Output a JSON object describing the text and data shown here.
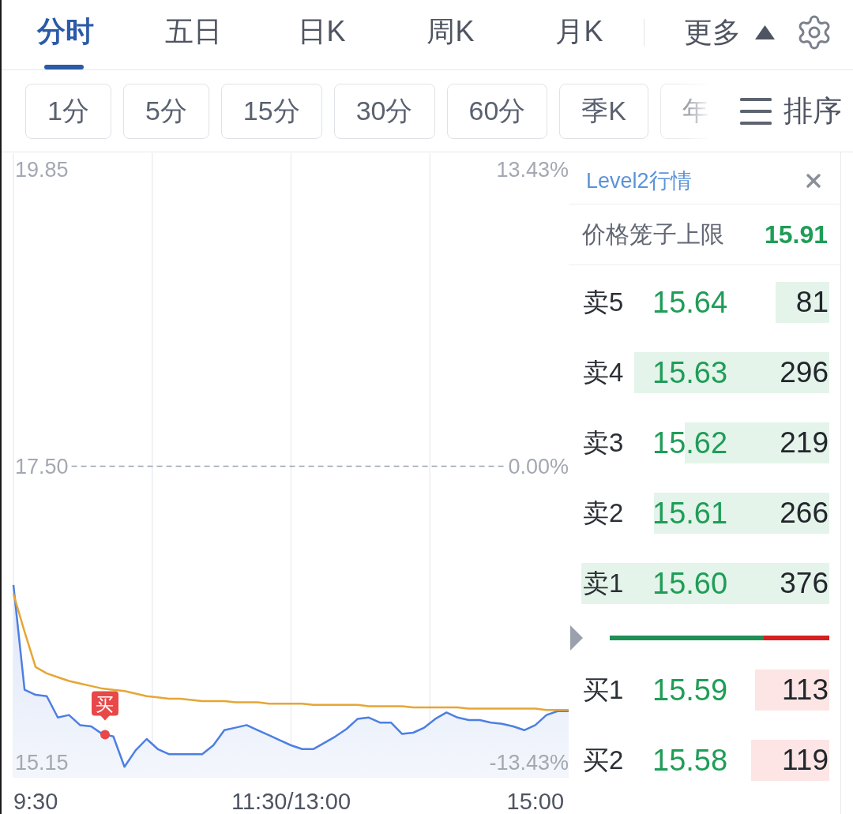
{
  "tabs": [
    {
      "label": "分时",
      "selected": true
    },
    {
      "label": "五日",
      "selected": false
    },
    {
      "label": "日K",
      "selected": false
    },
    {
      "label": "周K",
      "selected": false
    },
    {
      "label": "月K",
      "selected": false
    }
  ],
  "more": {
    "label": "更多",
    "expanded": true
  },
  "periods": [
    "1分",
    "5分",
    "15分",
    "30分",
    "60分",
    "季K",
    "年"
  ],
  "sort": {
    "label": "排序"
  },
  "chart": {
    "percent_labels": [
      "13.43%",
      "0.00%",
      "-13.43%"
    ],
    "chart_data": {
      "type": "line",
      "categories": [
        null,
        null,
        "9:30",
        null,
        null,
        null,
        null,
        null,
        null,
        null,
        null,
        null,
        null,
        null,
        null,
        null,
        null,
        null,
        null,
        null,
        null,
        null,
        null,
        null,
        null,
        "11:30/13:00",
        null,
        null,
        null,
        null,
        null,
        null,
        null,
        null,
        null,
        null,
        null,
        null,
        null,
        null,
        null,
        null,
        null,
        null,
        null,
        null,
        null,
        "15:00",
        null,
        null,
        null
      ],
      "ylim": [
        15.04,
        19.98
      ],
      "yticks": [
        {
          "value": 19.85,
          "label": "19.85"
        },
        {
          "value": 17.5,
          "label": "17.50"
        },
        {
          "value": 15.15,
          "label": "15.15"
        }
      ],
      "series": [
        {
          "color": "#4d7fe3",
          "values": [
            16.56,
            15.73,
            15.69,
            15.68,
            15.51,
            15.53,
            15.45,
            15.44,
            15.38,
            15.36,
            15.12,
            15.25,
            15.34,
            15.26,
            15.22,
            15.22,
            15.22,
            15.22,
            15.29,
            15.41,
            15.43,
            15.45,
            15.41,
            15.37,
            15.33,
            15.29,
            15.26,
            15.26,
            15.31,
            15.36,
            15.42,
            15.5,
            15.51,
            15.47,
            15.47,
            15.38,
            15.39,
            15.43,
            15.5,
            15.55,
            15.51,
            15.49,
            15.49,
            15.47,
            15.46,
            15.44,
            15.41,
            15.45,
            15.53,
            15.56,
            15.56
          ]
        },
        {
          "color": "#e6a634",
          "values": [
            16.49,
            16.19,
            15.91,
            15.86,
            15.83,
            15.8,
            15.78,
            15.76,
            15.74,
            15.73,
            15.72,
            15.7,
            15.68,
            15.67,
            15.66,
            15.66,
            15.65,
            15.64,
            15.64,
            15.64,
            15.63,
            15.63,
            15.63,
            15.62,
            15.62,
            15.62,
            15.62,
            15.61,
            15.61,
            15.61,
            15.61,
            15.61,
            15.6,
            15.6,
            15.6,
            15.6,
            15.59,
            15.59,
            15.59,
            15.59,
            15.59,
            15.58,
            15.58,
            15.58,
            15.58,
            15.58,
            15.58,
            15.58,
            15.57,
            15.57,
            15.57
          ]
        }
      ],
      "annotations": [
        "买"
      ]
    }
  },
  "order_book": {
    "title": "Level2行情",
    "price_cage": {
      "label": "价格笼子上限",
      "value": "15.91"
    },
    "asks": [
      {
        "label": "卖5",
        "price": "15.64",
        "volume": "81"
      },
      {
        "label": "卖4",
        "price": "15.63",
        "volume": "296"
      },
      {
        "label": "卖3",
        "price": "15.62",
        "volume": "219"
      },
      {
        "label": "卖2",
        "price": "15.61",
        "volume": "266"
      },
      {
        "label": "卖1",
        "price": "15.60",
        "volume": "376"
      }
    ],
    "ratio_bar": {
      "level": 0.7
    },
    "bids": [
      {
        "label": "买1",
        "price": "15.59",
        "volume": "113"
      },
      {
        "label": "买2",
        "price": "15.58",
        "volume": "119"
      }
    ]
  }
}
